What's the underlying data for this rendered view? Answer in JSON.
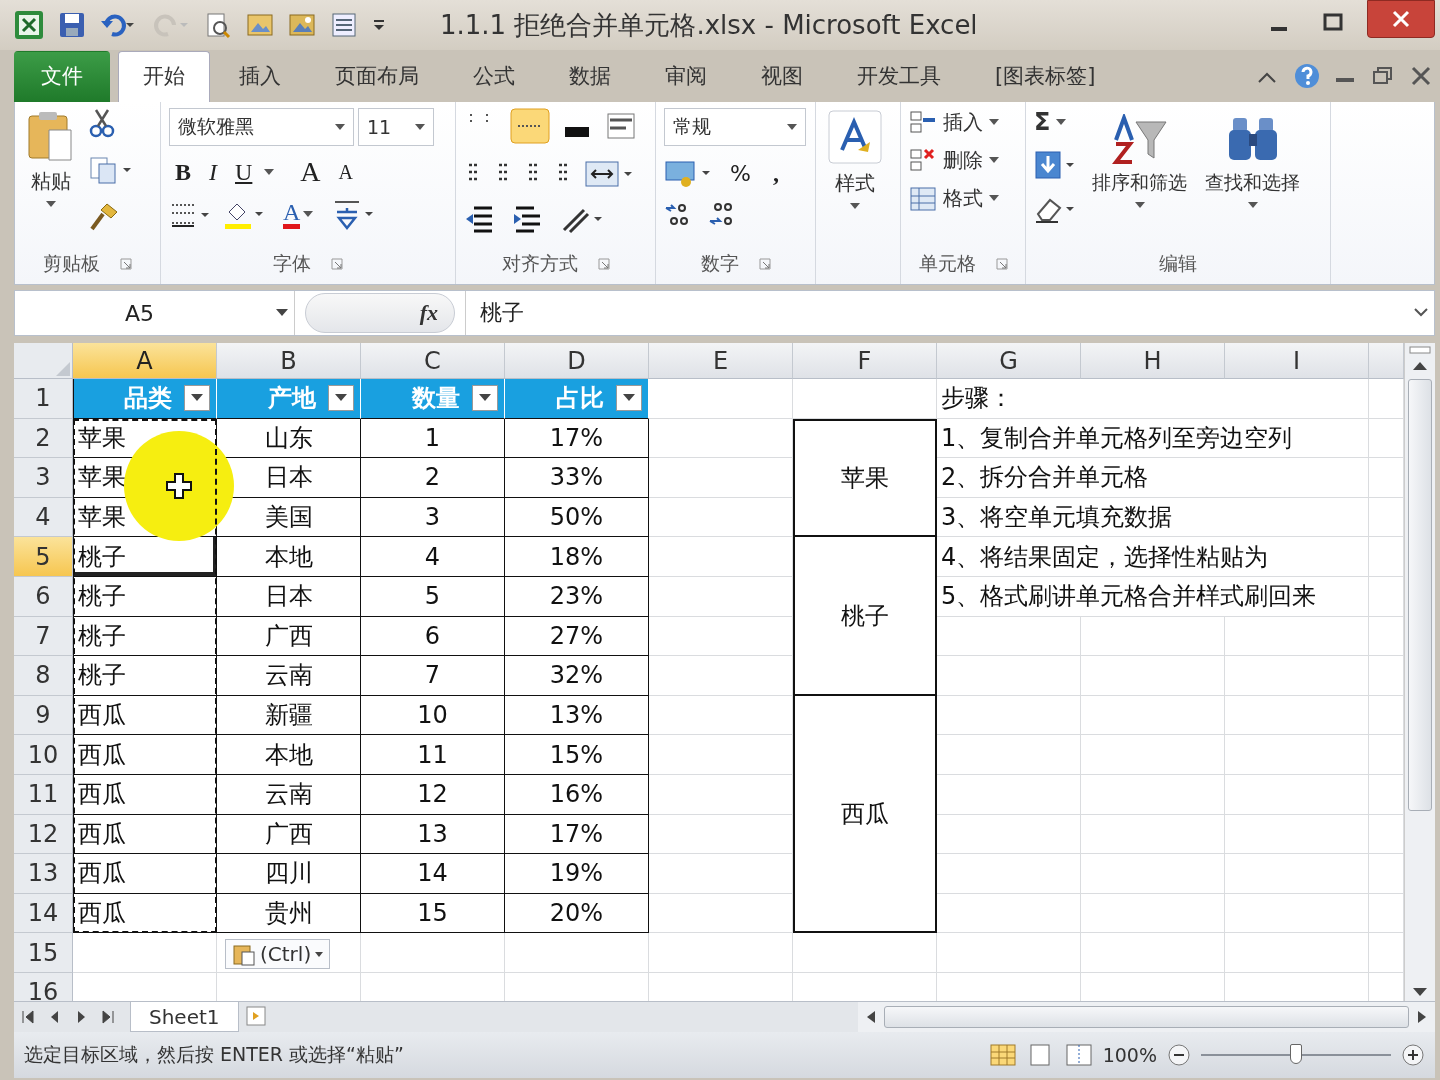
{
  "window": {
    "title": "1.1.1 拒绝合并单元格.xlsx  -  Microsoft Excel"
  },
  "ribbon_tabs": [
    {
      "label": "文件",
      "kind": "file",
      "selected": false
    },
    {
      "label": "开始",
      "kind": "tab",
      "selected": true
    },
    {
      "label": "插入",
      "kind": "tab",
      "selected": false
    },
    {
      "label": "页面布局",
      "kind": "tab",
      "selected": false
    },
    {
      "label": "公式",
      "kind": "tab",
      "selected": false
    },
    {
      "label": "数据",
      "kind": "tab",
      "selected": false
    },
    {
      "label": "审阅",
      "kind": "tab",
      "selected": false
    },
    {
      "label": "视图",
      "kind": "tab",
      "selected": false
    },
    {
      "label": "开发工具",
      "kind": "tab",
      "selected": false
    },
    {
      "label": "[图表标签]",
      "kind": "tab",
      "selected": false
    }
  ],
  "ribbon_groups": [
    {
      "kind": "clipboard",
      "label": "剪贴板",
      "paste": "粘贴"
    },
    {
      "kind": "font",
      "label": "字体",
      "font_name": "微软雅黑",
      "font_size": "11",
      "style_buttons": [
        "B",
        "I",
        "U"
      ],
      "grow_font": "A",
      "shrink_font": "A",
      "font_color": "A"
    },
    {
      "kind": "alignment",
      "label": "对齐方式"
    },
    {
      "kind": "number",
      "label": "数字",
      "format": "常规",
      "percent": "%",
      "comma": ","
    },
    {
      "kind": "styles",
      "button": "样式"
    },
    {
      "kind": "cells",
      "label": "单元格",
      "commands": [
        "插入",
        "删除",
        "格式"
      ]
    },
    {
      "kind": "editing",
      "label": "编辑",
      "autosum": "Σ",
      "commands": [
        "排序和筛选",
        "查找和选择"
      ]
    }
  ],
  "formula_bar": {
    "name_box": "A5",
    "function_button": "fx",
    "formula": "桃子"
  },
  "sheet": {
    "columns": [
      {
        "label": "A",
        "selected": true
      },
      {
        "label": "B",
        "selected": false
      },
      {
        "label": "C",
        "selected": false
      },
      {
        "label": "D",
        "selected": false
      },
      {
        "label": "E",
        "selected": false
      },
      {
        "label": "F",
        "selected": false
      },
      {
        "label": "G",
        "selected": false
      },
      {
        "label": "H",
        "selected": false
      },
      {
        "label": "I",
        "selected": false
      }
    ],
    "rows": [
      {
        "label": "1",
        "selected": false
      },
      {
        "label": "2",
        "selected": false
      },
      {
        "label": "3",
        "selected": false
      },
      {
        "label": "4",
        "selected": false
      },
      {
        "label": "5",
        "selected": true
      },
      {
        "label": "6",
        "selected": false
      },
      {
        "label": "7",
        "selected": false
      },
      {
        "label": "8",
        "selected": false
      },
      {
        "label": "9",
        "selected": false
      },
      {
        "label": "10",
        "selected": false
      },
      {
        "label": "11",
        "selected": false
      },
      {
        "label": "12",
        "selected": false
      },
      {
        "label": "13",
        "selected": false
      },
      {
        "label": "14",
        "selected": false
      },
      {
        "label": "15",
        "selected": false
      },
      {
        "label": "16",
        "selected": false
      }
    ],
    "table": {
      "columns": [
        {
          "header": "品类",
          "copied": true
        },
        {
          "header": "产地",
          "copied": false
        },
        {
          "header": "数量",
          "copied": false
        },
        {
          "header": "占比",
          "copied": false
        }
      ],
      "rows": [
        [
          "苹果",
          "山东",
          "1",
          "17%"
        ],
        [
          "苹果",
          "日本",
          "2",
          "33%"
        ],
        [
          "苹果",
          "美国",
          "3",
          "50%"
        ],
        [
          "桃子",
          "本地",
          "4",
          "18%"
        ],
        [
          "桃子",
          "日本",
          "5",
          "23%"
        ],
        [
          "桃子",
          "广西",
          "6",
          "27%"
        ],
        [
          "桃子",
          "云南",
          "7",
          "32%"
        ],
        [
          "西瓜",
          "新疆",
          "10",
          "13%"
        ],
        [
          "西瓜",
          "本地",
          "11",
          "15%"
        ],
        [
          "西瓜",
          "云南",
          "12",
          "16%"
        ],
        [
          "西瓜",
          "广西",
          "13",
          "17%"
        ],
        [
          "西瓜",
          "四川",
          "14",
          "19%"
        ],
        [
          "西瓜",
          "贵州",
          "15",
          "20%"
        ]
      ]
    },
    "column_f": [
      {
        "text": "苹果",
        "merged_with_above": false
      },
      {
        "merged_with_above": true
      },
      {
        "merged_with_above": true
      },
      {
        "text": "桃子",
        "merged_with_above": false
      },
      {
        "merged_with_above": true
      },
      {
        "merged_with_above": true
      },
      {
        "merged_with_above": true
      },
      {
        "text": "西瓜",
        "merged_with_above": false
      },
      {
        "merged_with_above": true
      },
      {
        "merged_with_above": true
      },
      {
        "merged_with_above": true
      },
      {
        "merged_with_above": true
      },
      {
        "merged_with_above": true
      }
    ],
    "notes": [
      "步骤：",
      "1、复制合并单元格列至旁边空列",
      "2、拆分合并单元格",
      "3、将空单元填充数据",
      "4、将结果固定，选择性粘贴为",
      "5、格式刷讲单元格合并样式刷回来"
    ],
    "paste_options": "(Ctrl)"
  },
  "sheet_tabs": [
    {
      "label": "Sheet1",
      "selected": true
    }
  ],
  "status_bar": {
    "message": "选定目标区域，然后按 ENTER 或选择“粘贴”",
    "zoom": "100%",
    "zoom_slider": {
      "level": 0.5
    }
  }
}
